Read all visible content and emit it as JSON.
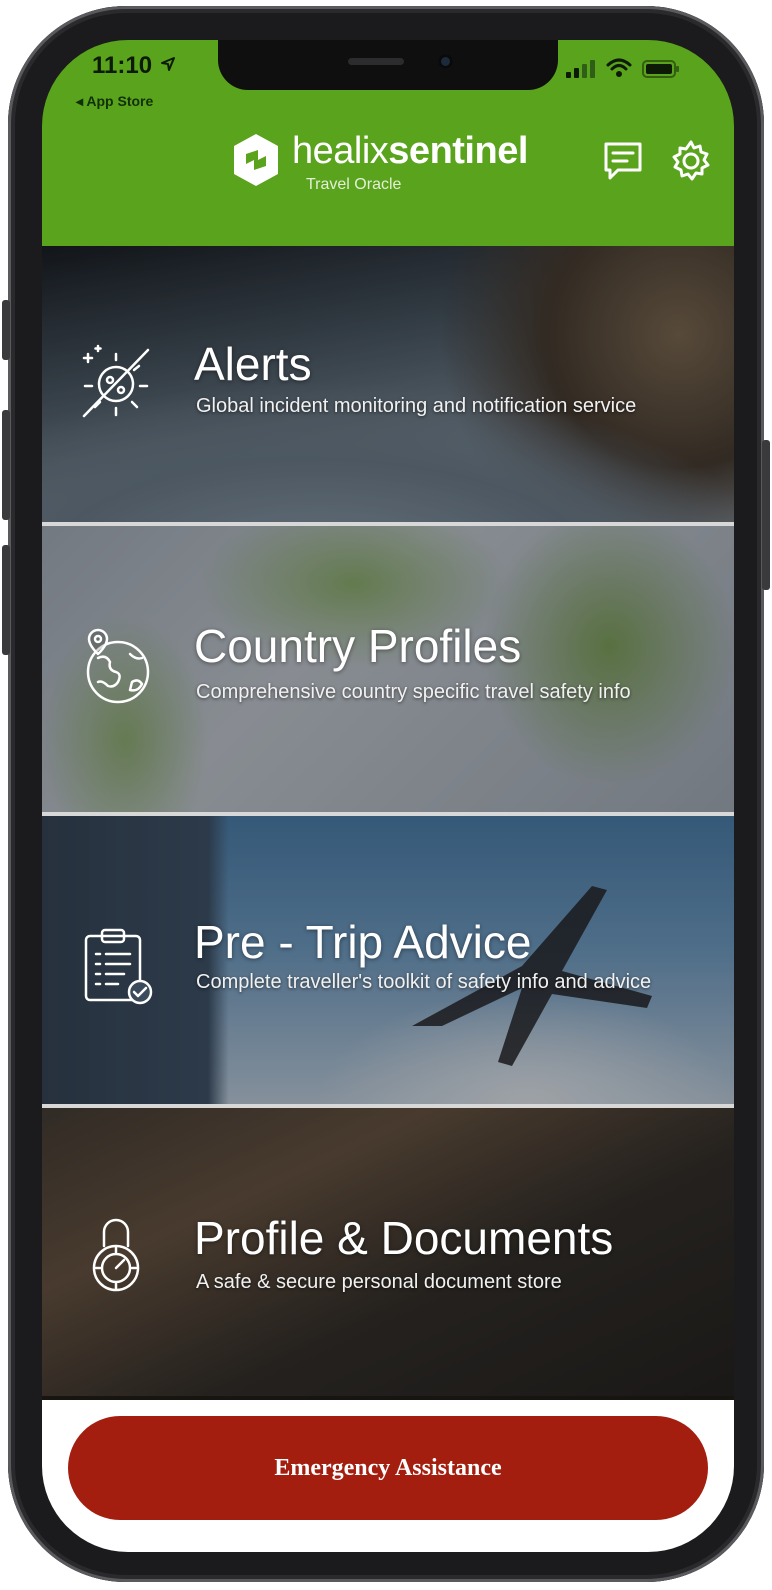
{
  "status_bar": {
    "time": "11:10",
    "back_label": "◂ App Store"
  },
  "header": {
    "brand_light": "healix",
    "brand_bold": "sentinel",
    "brand_sub": "Travel Oracle",
    "background_color": "#5aa31c",
    "chat_icon": "chat-icon",
    "settings_icon": "gear-icon"
  },
  "tiles": [
    {
      "title": "Alerts",
      "description": "Global incident monitoring and notification service",
      "icon": "no-virus-icon"
    },
    {
      "title": "Country Profiles",
      "description": "Comprehensive country specific travel safety info",
      "icon": "globe-pin-icon"
    },
    {
      "title": "Pre - Trip Advice",
      "description": "Complete traveller's toolkit of safety info and advice",
      "icon": "clipboard-check-icon"
    },
    {
      "title": "Profile & Documents",
      "description": "A safe & secure personal document store",
      "icon": "padlock-icon"
    }
  ],
  "emergency": {
    "label": "Emergency Assistance",
    "color": "#a41e10"
  }
}
